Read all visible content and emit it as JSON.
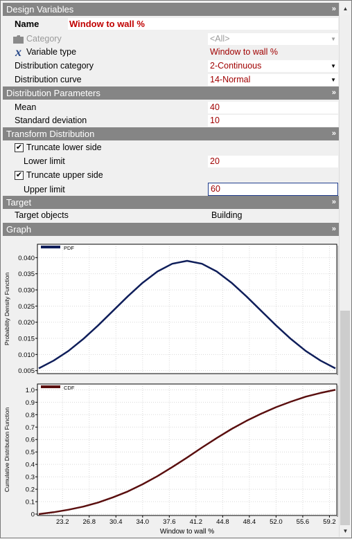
{
  "sections": {
    "design_variables": "Design Variables",
    "distribution_parameters": "Distribution Parameters",
    "transform_distribution": "Transform Distribution",
    "target": "Target",
    "graph": "Graph"
  },
  "collapse_glyph": "»",
  "name": {
    "label": "Name",
    "value": "Window to wall %"
  },
  "category": {
    "label": "Category",
    "value": "<All>"
  },
  "variable_type": {
    "label": "Variable type",
    "value": "Window to wall %"
  },
  "distribution_category": {
    "label": "Distribution category",
    "value": "2-Continuous"
  },
  "distribution_curve": {
    "label": "Distribution curve",
    "value": "14-Normal"
  },
  "mean": {
    "label": "Mean",
    "value": "40"
  },
  "std": {
    "label": "Standard deviation",
    "value": "10"
  },
  "truncate_lower": {
    "label": "Truncate lower side",
    "checked": true
  },
  "lower_limit": {
    "label": "Lower limit",
    "value": "20"
  },
  "truncate_upper": {
    "label": "Truncate upper side",
    "checked": true
  },
  "upper_limit": {
    "label": "Upper limit",
    "value": "60"
  },
  "target_objects": {
    "label": "Target objects",
    "value": "Building"
  },
  "chart_data": [
    {
      "type": "line",
      "legend": "PDF",
      "ylabel": "Probability Density Function",
      "color": "#0f1e5a",
      "xlim": [
        20,
        60
      ],
      "ylim": [
        0.0045,
        0.0435
      ],
      "yticks": [
        "0.005",
        "0.010",
        "0.015",
        "0.020",
        "0.025",
        "0.030",
        "0.035",
        "0.040"
      ],
      "ytick_values": [
        0.005,
        0.01,
        0.015,
        0.02,
        0.025,
        0.03,
        0.035,
        0.04
      ],
      "series": [
        {
          "x": [
            20,
            22,
            24,
            26,
            28,
            30,
            32,
            34,
            36,
            38,
            40,
            42,
            44,
            46,
            48,
            50,
            52,
            54,
            56,
            58,
            60
          ],
          "y": [
            0.0057,
            0.0081,
            0.0111,
            0.0148,
            0.019,
            0.0235,
            0.028,
            0.0322,
            0.0357,
            0.0381,
            0.039,
            0.0381,
            0.0357,
            0.0322,
            0.028,
            0.0235,
            0.019,
            0.0148,
            0.0111,
            0.0081,
            0.0057
          ]
        }
      ]
    },
    {
      "type": "line",
      "legend": "CDF",
      "ylabel": "Cumulative Distribution Function",
      "xlabel": "Window to wall %",
      "color": "#5a0f0f",
      "xlim": [
        20,
        60
      ],
      "ylim": [
        0,
        1.03
      ],
      "yticks": [
        "0",
        "0.1",
        "0.2",
        "0.3",
        "0.4",
        "0.5",
        "0.6",
        "0.7",
        "0.8",
        "0.9",
        "1.0"
      ],
      "ytick_values": [
        0,
        0.1,
        0.2,
        0.3,
        0.4,
        0.5,
        0.6,
        0.7,
        0.8,
        0.9,
        1.0
      ],
      "xticks": [
        "23.2",
        "26.8",
        "30.4",
        "34.0",
        "37.6",
        "41.2",
        "44.8",
        "48.4",
        "52.0",
        "55.6",
        "59.2"
      ],
      "xtick_values": [
        23.2,
        26.8,
        30.4,
        34.0,
        37.6,
        41.2,
        44.8,
        48.4,
        52.0,
        55.6,
        59.2
      ],
      "series": [
        {
          "x": [
            20,
            22,
            24,
            26,
            28,
            30,
            32,
            34,
            36,
            38,
            40,
            42,
            44,
            46,
            48,
            50,
            52,
            54,
            56,
            58,
            60
          ],
          "y": [
            0.0,
            0.015,
            0.035,
            0.06,
            0.093,
            0.135,
            0.182,
            0.24,
            0.305,
            0.378,
            0.455,
            0.535,
            0.612,
            0.685,
            0.75,
            0.808,
            0.86,
            0.905,
            0.945,
            0.975,
            1.0
          ]
        }
      ]
    }
  ]
}
